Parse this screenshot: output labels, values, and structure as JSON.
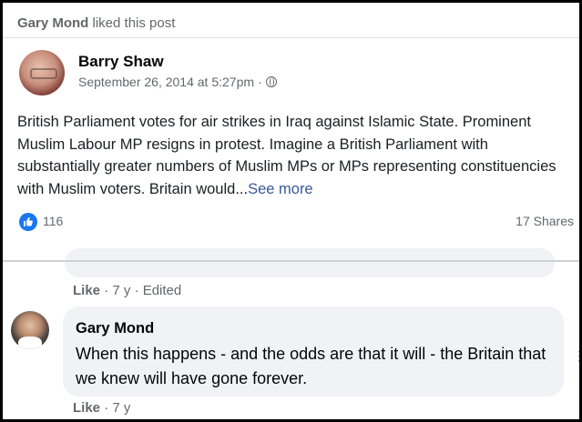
{
  "activity": {
    "actor": "Gary Mond",
    "action": "liked this post"
  },
  "post": {
    "author": "Barry Shaw",
    "timestamp": "September 26, 2014 at 5:27pm",
    "separator": "·",
    "privacy_icon": "globe-icon",
    "text": "British Parliament votes for air strikes in Iraq against Islamic State. Prominent Muslim Labour MP resigns in protest. Imagine a British Parliament with substantially greater numbers of Muslim MPs or MPs representing constituencies with Muslim voters. Britain would...",
    "see_more": "See more",
    "like_count": "116",
    "shares": "17 Shares"
  },
  "previous_comment_actions": {
    "like": "Like",
    "meta": "· 7 y · Edited"
  },
  "comment": {
    "author": "Gary Mond",
    "text": "When this happens - and the odds are that it will - the Britain that we knew will have gone forever.",
    "like": "Like",
    "meta": "· 7 y"
  },
  "colors": {
    "accent": "#1877f2",
    "link": "#385898",
    "muted_text": "#65676b",
    "bubble_bg": "#f0f2f5"
  }
}
